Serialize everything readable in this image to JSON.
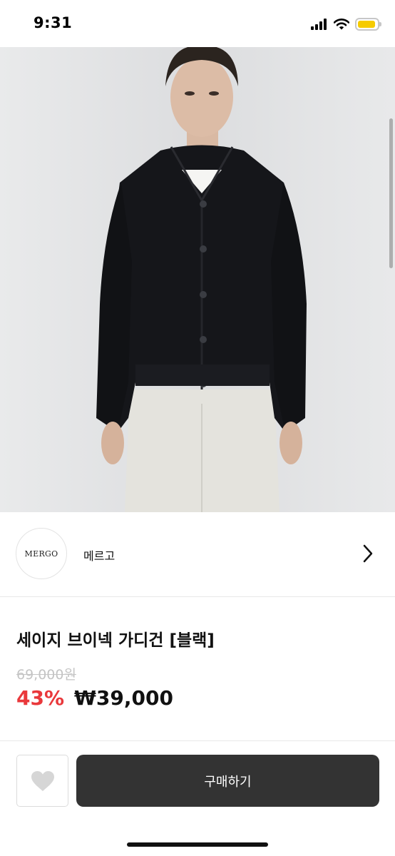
{
  "status_bar": {
    "time": "9:31",
    "icons": [
      "signal-icon",
      "wifi-icon",
      "battery-icon"
    ],
    "battery_level": 0.8,
    "battery_color": "#f6cb00"
  },
  "product_image": {
    "icon": "product-photo",
    "description": ""
  },
  "shop": {
    "logo_text": "MERGO",
    "name": "메르고",
    "chevron_icon": "chevron-right-icon"
  },
  "product": {
    "title": "세이지 브이넥 가디건 [블랙]",
    "original_price": "69,000원",
    "discount_rate": "43%",
    "sale_price": "₩39,000",
    "discount_color": "#e9383b"
  },
  "actions": {
    "like_icon": "heart-icon",
    "buy_label": "구매하기"
  }
}
